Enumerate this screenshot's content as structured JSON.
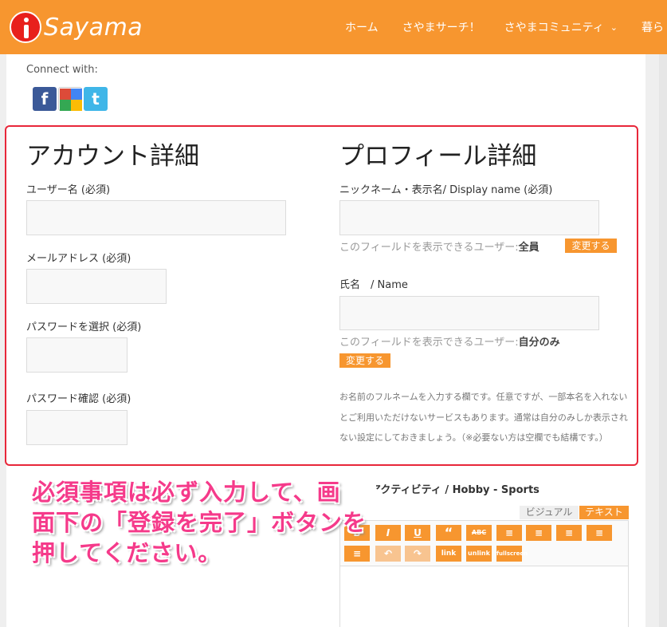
{
  "header": {
    "logo_text": "Sayama",
    "nav": [
      {
        "label": "ホーム"
      },
      {
        "label": "さやまサーチ！"
      },
      {
        "label": "さやまコミュニティ"
      },
      {
        "label": "暮ら"
      }
    ]
  },
  "connect": {
    "label": "Connect with:",
    "icons": [
      "facebook-icon",
      "google-icon",
      "twitter-icon"
    ]
  },
  "account": {
    "heading": "アカウント詳細",
    "username_label": "ユーザー名 (必須)",
    "email_label": "メールアドレス (必須)",
    "password_label": "パスワードを選択 (必須)",
    "password_confirm_label": "パスワード確認 (必須)"
  },
  "profile": {
    "heading": "プロフィール詳細",
    "nickname_label": "ニックネーム・表示名/ Display name (必須)",
    "visibility_prefix": "このフィールドを表示できるユーザー:",
    "nickname_visibility": "全員",
    "change_label": "変更する",
    "name_label": "氏名　/ Name",
    "name_visibility": "自分のみ",
    "note": "お名前のフルネームを入力する欄です。任意ですが、一部本名を入れないとご利用いただけないサービスもあります。通常は自分のみしか表示されない設定にしておきましょう。（※必要ない方は空欄でも結構です。）",
    "hobby_label": "趣味・アクティビティ / Hobby - Sports"
  },
  "overlay_text": {
    "line1": "必須事項は必ず入力して、画",
    "line2": "面下の「登録を完了」ボタンを",
    "line3": "押してください。"
  },
  "editor": {
    "tab_visual": "ビジュアル",
    "tab_text": "テキスト",
    "buttons": [
      "B",
      "I",
      "U",
      "“",
      "ABC",
      "≡",
      "≡",
      "≡",
      "≡",
      "≡",
      "↶",
      "↷",
      "link",
      "unlink",
      "fullscreen"
    ]
  },
  "colors": {
    "accent": "#f7962f",
    "highlight_border": "#e8273a",
    "overlay_text": "#f53a8a"
  }
}
